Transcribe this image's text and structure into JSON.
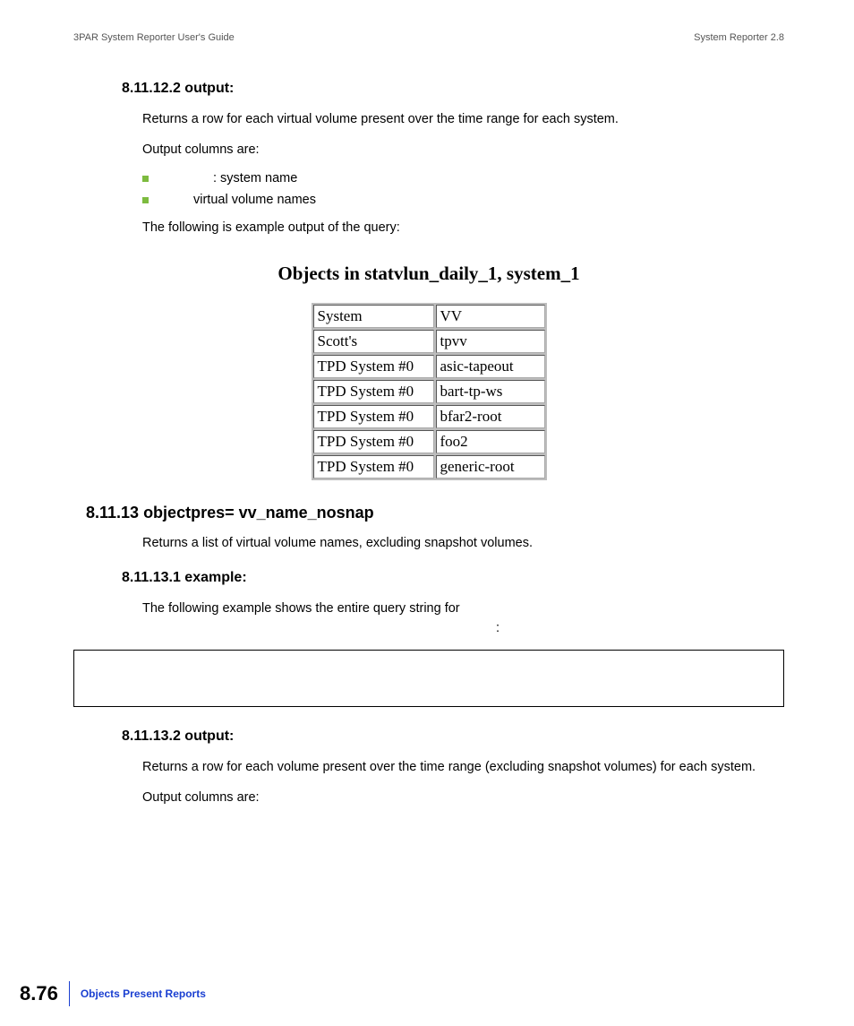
{
  "header": {
    "left": "3PAR System Reporter User's Guide",
    "right": "System Reporter 2.8"
  },
  "sec1": {
    "heading": "8.11.12.2 output:",
    "p1": "Returns a row for each virtual volume present over the time range for each system.",
    "p2": "Output columns are:",
    "b1": ": system name",
    "b2": "virtual volume names",
    "p3": "The following is example output of the query:"
  },
  "table": {
    "title": "Objects in statvlun_daily_1, system_1",
    "rows": [
      {
        "c1": "System",
        "c2": "VV"
      },
      {
        "c1": "Scott's",
        "c2": "tpvv"
      },
      {
        "c1": "TPD System #0",
        "c2": "asic-tapeout"
      },
      {
        "c1": "TPD System #0",
        "c2": "bart-tp-ws"
      },
      {
        "c1": "TPD System #0",
        "c2": "bfar2-root"
      },
      {
        "c1": "TPD System #0",
        "c2": "foo2"
      },
      {
        "c1": "TPD System #0",
        "c2": "generic-root"
      }
    ]
  },
  "sec2": {
    "heading": "8.11.13 objectpres= vv_name_nosnap",
    "p1": "Returns a list of virtual volume names, excluding snapshot volumes."
  },
  "sec3": {
    "heading": "8.11.13.1 example:",
    "p1a": "The following example shows the entire query string for",
    "p1b": ":"
  },
  "sec4": {
    "heading": "8.11.13.2 output:",
    "p1": "Returns a row for each volume present over the time range (excluding snapshot volumes) for each system.",
    "p2": "Output columns are:"
  },
  "footer": {
    "pagenum": "8.76",
    "title": "Objects Present Reports"
  }
}
